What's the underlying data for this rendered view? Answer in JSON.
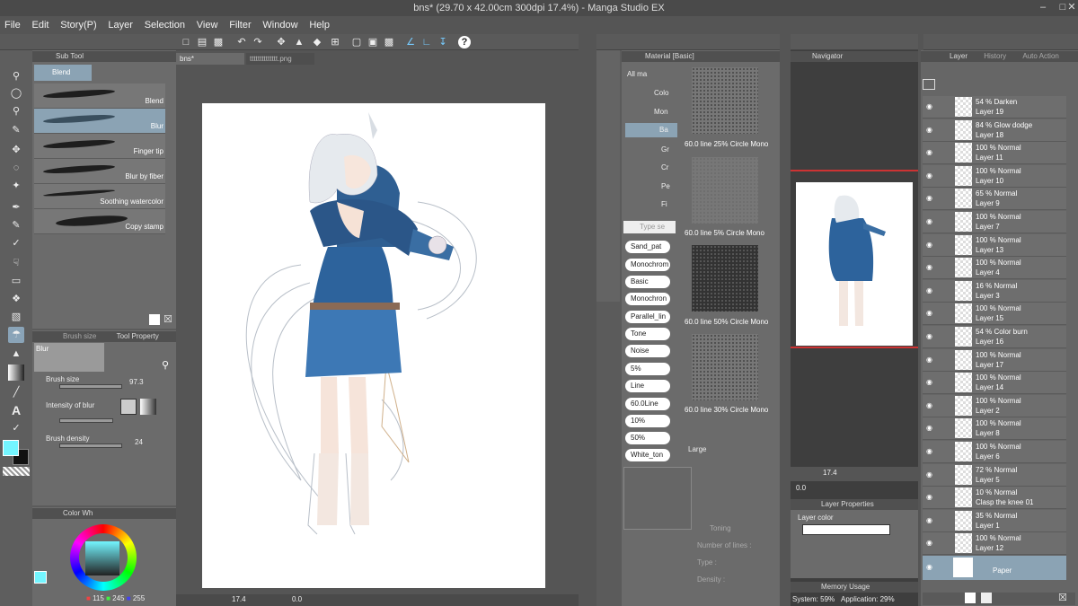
{
  "title": "bns* (29.70 x 42.00cm 300dpi 17.4%)  - Manga Studio EX",
  "menu": [
    "File",
    "Edit",
    "Story(P)",
    "Layer",
    "Selection",
    "View",
    "Filter",
    "Window",
    "Help"
  ],
  "canvas_tabs": [
    "bns*",
    "tttttttttttttt.png"
  ],
  "subtool": {
    "header": "Sub Tool",
    "group": "Blend",
    "brushes": [
      "Blend",
      "Blur",
      "Finger tip",
      "Blur by fiber",
      "Soothing watercolor",
      "Copy stamp"
    ]
  },
  "tool_property": {
    "tabs": [
      "Brush size",
      "Tool Property"
    ],
    "name": "Blur",
    "brush_size_label": "Brush size",
    "brush_size": "97.3",
    "intensity_label": "Intensity of blur",
    "density_label": "Brush density",
    "density": "24"
  },
  "color_wheel": {
    "header": "Color Wh",
    "r": "115",
    "g": "245",
    "b": "255",
    "color": "#73f5ff"
  },
  "canvas_status": {
    "zoom": "17.4",
    "angle": "0.0"
  },
  "material": {
    "header": "Material [Basic]",
    "tree": [
      "All ma",
      "Colo",
      "Mon",
      "Ba",
      "Gr",
      "Cr",
      "Pe",
      "Fi"
    ],
    "search_placeholder": "Type se",
    "tags": [
      "Sand_pat",
      "Monochrom",
      "Basic",
      "Monochron",
      "Parallel_lin",
      "Tone",
      "Noise",
      "5%",
      "Line",
      "60.0Line",
      "10%",
      "50%",
      "White_ton"
    ],
    "tones": [
      "60.0 line 25% Circle Mono",
      "60.0 line 5% Circle Mono",
      "60.0 line 50% Circle Mono",
      "60.0 line 30% Circle Mono"
    ],
    "size": "Large",
    "toning": "Toning",
    "lines": "Number of lines :",
    "type": "Type :",
    "density": "Density :"
  },
  "navigator": {
    "header": "Navigator",
    "zoom": "17.4",
    "angle": "0.0"
  },
  "layer_property": {
    "header": "Layer Properties",
    "label": "Layer color"
  },
  "memory": {
    "header": "Memory Usage",
    "system": "System: 59%",
    "app": "Application: 29%"
  },
  "layer_panel": {
    "tabs": [
      "Layer",
      "History",
      "Auto Action"
    ],
    "layers": [
      {
        "mode": "54 %  Darken",
        "name": "Layer 19"
      },
      {
        "mode": "84 %  Glow dodge",
        "name": "Layer 18"
      },
      {
        "mode": "100 %  Normal",
        "name": "Layer 11"
      },
      {
        "mode": "100 %  Normal",
        "name": "Layer 10"
      },
      {
        "mode": "65 %  Normal",
        "name": "Layer 9"
      },
      {
        "mode": "100 %  Normal",
        "name": "Layer 7"
      },
      {
        "mode": "100 %  Normal",
        "name": "Layer 13"
      },
      {
        "mode": "100 %  Normal",
        "name": "Layer 4"
      },
      {
        "mode": "16 %  Normal",
        "name": "Layer 3"
      },
      {
        "mode": "100 %  Normal",
        "name": "Layer 15"
      },
      {
        "mode": "54 %  Color burn",
        "name": "Layer 16"
      },
      {
        "mode": "100 %  Normal",
        "name": "Layer 17"
      },
      {
        "mode": "100 %  Normal",
        "name": "Layer 14"
      },
      {
        "mode": "100 %  Normal",
        "name": "Layer 2"
      },
      {
        "mode": "100 %  Normal",
        "name": "Layer 8"
      },
      {
        "mode": "100 %  Normal",
        "name": "Layer 6"
      },
      {
        "mode": "72 %  Normal",
        "name": "Layer 5"
      },
      {
        "mode": "10 %  Normal",
        "name": "Clasp the knee 01"
      },
      {
        "mode": "35 %  Normal",
        "name": "Layer 1"
      },
      {
        "mode": "100 %  Normal",
        "name": "Layer 12"
      }
    ],
    "paper": "Paper"
  }
}
